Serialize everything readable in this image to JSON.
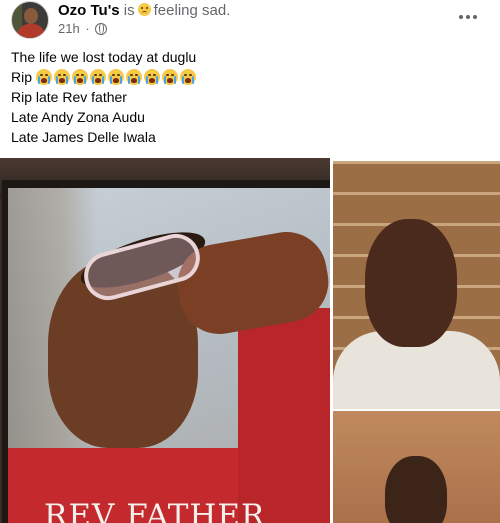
{
  "post": {
    "author": "Ozo Tu's",
    "status_prefix": "is",
    "feeling_icon": "sad-face-emoji",
    "feeling_text": "feeling sad.",
    "timestamp": "21h",
    "separator": "·",
    "audience_icon": "globe-icon",
    "more_icon": "more-options-icon",
    "lines": [
      "The life we lost today at duglu",
      "Rip",
      "Rip late Rev father",
      "Late Andy Zona Audu",
      "Late James Delle Iwala"
    ],
    "rip_emoji": "loudly-crying-face-emoji",
    "rip_emoji_count": 9
  },
  "photos": {
    "main_caption": "REV FATHER"
  }
}
